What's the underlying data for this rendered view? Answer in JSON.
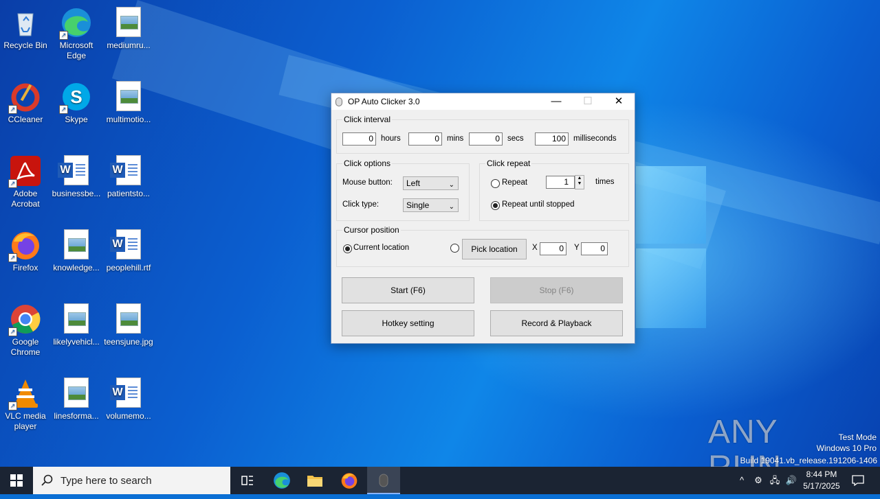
{
  "desktop": {
    "icons": [
      {
        "label": "Recycle Bin",
        "icon": "recycle-bin-icon"
      },
      {
        "label": "Microsoft Edge",
        "icon": "edge-icon"
      },
      {
        "label": "mediumru...",
        "icon": "image-file-icon"
      },
      {
        "label": "CCleaner",
        "icon": "ccleaner-icon"
      },
      {
        "label": "Skype",
        "icon": "skype-icon"
      },
      {
        "label": "multimotio...",
        "icon": "image-file-icon"
      },
      {
        "label": "Adobe Acrobat",
        "icon": "acrobat-icon"
      },
      {
        "label": "businessbe...",
        "icon": "word-file-icon"
      },
      {
        "label": "patientsto...",
        "icon": "word-file-icon"
      },
      {
        "label": "Firefox",
        "icon": "firefox-icon"
      },
      {
        "label": "knowledge...",
        "icon": "image-file-icon"
      },
      {
        "label": "peoplehill.rtf",
        "icon": "word-file-icon"
      },
      {
        "label": "Google Chrome",
        "icon": "chrome-icon"
      },
      {
        "label": "likelyvehicl...",
        "icon": "image-file-icon"
      },
      {
        "label": "teensjune.jpg",
        "icon": "image-file-icon"
      },
      {
        "label": "VLC media player",
        "icon": "vlc-icon"
      },
      {
        "label": "linesforma...",
        "icon": "image-file-icon"
      },
      {
        "label": "volumemo...",
        "icon": "word-file-icon"
      }
    ]
  },
  "window": {
    "title": "OP Auto Clicker 3.0",
    "minimize": "—",
    "maximize": "☐",
    "close": "✕",
    "click_interval": {
      "label": "Click interval",
      "hours": "0",
      "hours_label": "hours",
      "mins": "0",
      "mins_label": "mins",
      "secs": "0",
      "secs_label": "secs",
      "ms": "100",
      "ms_label": "milliseconds"
    },
    "click_options": {
      "label": "Click options",
      "mouse_button_label": "Mouse button:",
      "mouse_button_value": "Left",
      "click_type_label": "Click type:",
      "click_type_value": "Single"
    },
    "click_repeat": {
      "label": "Click repeat",
      "repeat_label": "Repeat",
      "repeat_count": "1",
      "times_label": "times",
      "until_stopped_label": "Repeat until stopped"
    },
    "cursor_position": {
      "label": "Cursor position",
      "current_location_label": "Current location",
      "pick_location_label": "Pick location",
      "x_label": "X",
      "x_value": "0",
      "y_label": "Y",
      "y_value": "0"
    },
    "buttons": {
      "start": "Start (F6)",
      "stop": "Stop (F6)",
      "hotkey": "Hotkey setting",
      "record": "Record & Playback"
    }
  },
  "taskbar": {
    "search_placeholder": "Type here to search",
    "time": "8:44 PM",
    "date": "5/17/2025"
  },
  "watermark": {
    "brand": "ANY RUN",
    "line1": "Test Mode",
    "line2": "Windows 10 Pro",
    "line3": "Build 19041.vb_release.191206-1406"
  }
}
